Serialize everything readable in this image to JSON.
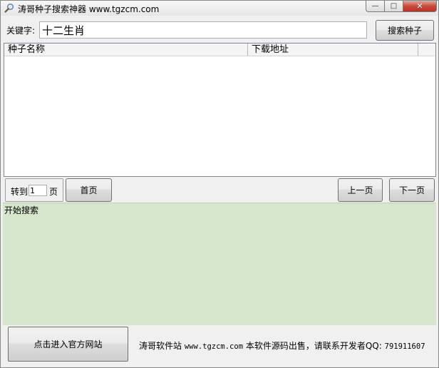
{
  "window": {
    "title": "涛哥种子搜索神器 www.tgzcm.com",
    "minimize_label": "—",
    "maximize_label": "□",
    "close_label": "✕",
    "icon": "magnifier-icon"
  },
  "search": {
    "keyword_label": "关键字:",
    "keyword_value": "十二生肖",
    "search_button_label": "搜索种子"
  },
  "results": {
    "columns": [
      "种子名称",
      "下载地址"
    ],
    "rows": []
  },
  "paging": {
    "goto_prefix": "转到",
    "goto_value": "1",
    "goto_suffix": "页",
    "first_label": "首页",
    "prev_label": "上一页",
    "next_label": "下一页"
  },
  "log": {
    "text": "开始搜索"
  },
  "footer": {
    "official_button_label": "点击进入官方网站",
    "site_name": "涛哥软件站",
    "site_url": "www.tgzcm.com",
    "notice": "本软件源码出售，请联系开发者QQ:",
    "qq": "791911607"
  },
  "colors": {
    "log_background": "#d6e6cc",
    "window_background": "#f0f0f0",
    "close_button": "#c9493a"
  }
}
